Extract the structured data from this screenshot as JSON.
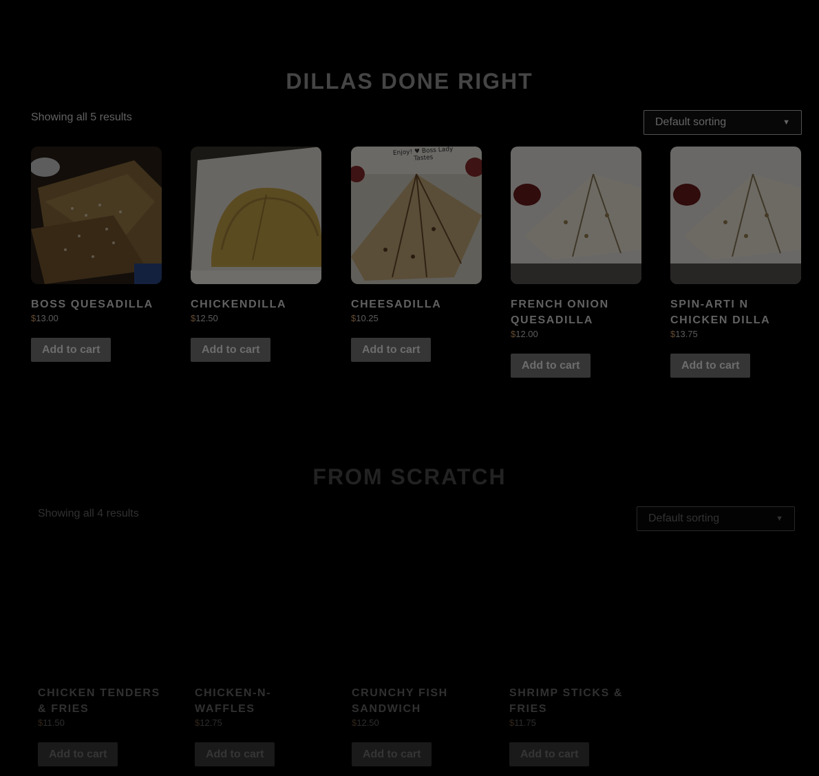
{
  "sections": [
    {
      "title": "DILLAS DONE RIGHT",
      "result_count": "Showing all 5 results",
      "sort_selected": "Default sorting",
      "products": [
        {
          "name": "BOSS QUESADILLA",
          "currency": "$",
          "amount": "13.00",
          "button": "Add to cart"
        },
        {
          "name": "CHICKENDILLA",
          "currency": "$",
          "amount": "12.50",
          "button": "Add to cart"
        },
        {
          "name": "CHEESADILLA",
          "currency": "$",
          "amount": "10.25",
          "button": "Add to cart"
        },
        {
          "name": "FRENCH ONION QUESADILLA",
          "currency": "$",
          "amount": "12.00",
          "button": "Add to cart"
        },
        {
          "name": "SPIN-ARTI N CHICKEN DILLA",
          "currency": "$",
          "amount": "13.75",
          "button": "Add to cart"
        }
      ]
    },
    {
      "title": "FROM SCRATCH",
      "result_count": "Showing all 4 results",
      "sort_selected": "Default sorting",
      "products": [
        {
          "name": "CHICKEN TENDERS & FRIES",
          "currency": "$",
          "amount": "11.50",
          "button": "Add to cart"
        },
        {
          "name": "CHICKEN-N-WAFFLES",
          "currency": "$",
          "amount": "12.75",
          "button": "Add to cart"
        },
        {
          "name": "CRUNCHY FISH SANDWICH",
          "currency": "$",
          "amount": "12.50",
          "button": "Add to cart"
        },
        {
          "name": "SHRIMP STICKS & FRIES",
          "currency": "$",
          "amount": "11.75",
          "button": "Add to cart"
        }
      ]
    }
  ],
  "image_note_text": "Enjoy! ♥ Boss Lady Tastes",
  "icons": {
    "sort_caret": "chevron-down-icon"
  }
}
